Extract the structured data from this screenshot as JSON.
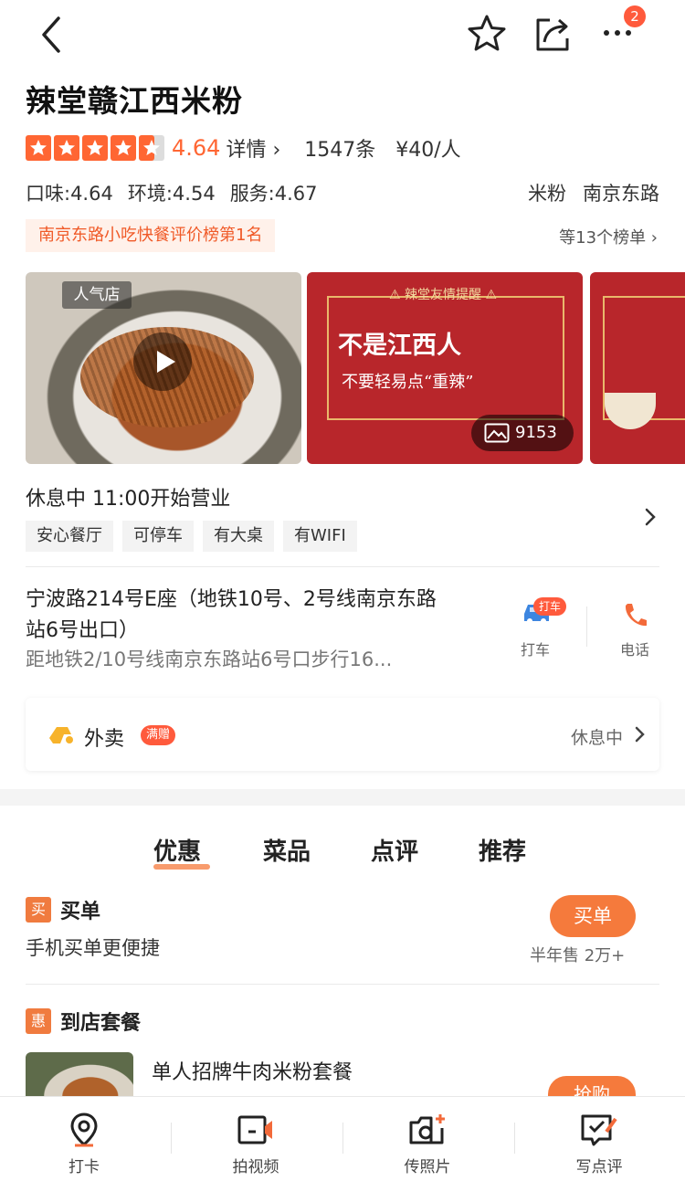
{
  "topbar": {
    "badge_count": "2",
    "icons": [
      "back-arrow-icon",
      "star-outline-icon",
      "share-icon",
      "more-icon"
    ]
  },
  "shop": {
    "name": "辣堂赣江西米粉",
    "rating": 4.64,
    "score_text": "4.64",
    "detail_link": "详情",
    "review_count": "1547条",
    "avg_price": "¥40/人",
    "taste": "口味:4.64",
    "environment": "环境:4.54",
    "service": "服务:4.67",
    "category": "米粉",
    "area": "南京东路",
    "rank_tag": "南京东路小吃快餐评价榜第1名",
    "rank_more": "等13个榜单"
  },
  "photos": {
    "hot_tag": "人气店",
    "warn_line": "⚠ 辣堂友情提醒 ⚠",
    "banner_line1": "不是江西人",
    "banner_line2": "不要轻易点“重辣”",
    "photo_count": "9153"
  },
  "hours": {
    "status": "休息中  11:00开始营业",
    "features": [
      "安心餐厅",
      "可停车",
      "有大桌",
      "有WIFI"
    ]
  },
  "address": {
    "line": "宁波路214号E座（地铁10号、2号线南京东路站6号出口）",
    "distance": "距地铁2/10号线南京东路站6号口步行16...",
    "taxi_badge": "打车",
    "taxi_label": "打车",
    "phone_label": "电话"
  },
  "takeout": {
    "label": "外卖",
    "badge": "满赠",
    "status": "休息中"
  },
  "tabs": [
    "优惠",
    "菜品",
    "点评",
    "推荐"
  ],
  "active_tab": "优惠",
  "offers": {
    "pay_icon": "买",
    "pay_title": "买单",
    "pay_sub": "手机买单更便捷",
    "pay_button": "买单",
    "pay_sold": "半年售 2万+",
    "set_icon": "惠",
    "set_title": "到店套餐",
    "set_item": "单人招牌牛肉米粉套餐",
    "set_button": "抢购"
  },
  "bottom_bar": [
    {
      "label": "打卡",
      "icon": "location-pin-icon"
    },
    {
      "label": "拍视频",
      "icon": "video-camera-icon"
    },
    {
      "label": "传照片",
      "icon": "photo-upload-icon"
    },
    {
      "label": "写点评",
      "icon": "write-review-icon"
    }
  ],
  "colors": {
    "accent": "#f57a3c",
    "rating": "#ff6633",
    "badge": "#ff5a3c"
  }
}
